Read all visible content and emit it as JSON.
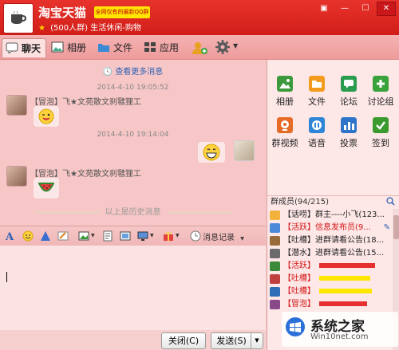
{
  "window": {
    "title": "淘宝天猫",
    "badge": "全网仅有的最新QQ群",
    "member_count": "(500人群)",
    "category": "生活休闲-购物",
    "controls": [
      "▣",
      "—",
      "☐",
      "✕"
    ]
  },
  "tabs": [
    {
      "label": "聊天",
      "icon": "chat-icon",
      "active": true
    },
    {
      "label": "相册",
      "icon": "album-icon"
    },
    {
      "label": "文件",
      "icon": "file-icon"
    },
    {
      "label": "应用",
      "icon": "apps-icon"
    }
  ],
  "chat": {
    "more_messages": "查看更多消息",
    "history_divider": "以上是历史消息",
    "messages": [
      {
        "time": "2014-4-10 19:05:52",
        "sender_tag": "【冒泡】",
        "sender": "飞★文苑散文刹毽狸工",
        "content": "wink-emoji"
      },
      {
        "time": "2014-4-10 19:14:04",
        "sender_tag": "",
        "sender": "",
        "content": "grin-emoji",
        "self": true
      },
      {
        "time": "",
        "sender_tag": "【冒泡】",
        "sender": "飞★文苑散文刹毽狸工",
        "content": "watermelon-emoji"
      }
    ]
  },
  "input_toolbar": {
    "message_record": "消息记录"
  },
  "buttons": {
    "close": "关闭(C)",
    "send": "发送(S)"
  },
  "apps": [
    {
      "label": "相册",
      "color": "#3c9a3c"
    },
    {
      "label": "文件",
      "color": "#f29c1f"
    },
    {
      "label": "论坛",
      "color": "#2a9c4f"
    },
    {
      "label": "讨论组",
      "color": "#3aa23a"
    },
    {
      "label": "群视频",
      "color": "#e56b26"
    },
    {
      "label": "语音",
      "color": "#2f86d6"
    },
    {
      "label": "投票",
      "color": "#2e74c9"
    },
    {
      "label": "签到",
      "color": "#3a9a2e"
    }
  ],
  "members": {
    "header": "群成员(94/215)",
    "list": [
      {
        "tag": "【话唠】",
        "name": "群主----小飞(123..."
      },
      {
        "tag": "【活跃】",
        "name": "信息发布员(9...",
        "red": true
      },
      {
        "tag": "【吐槽】",
        "name": "进群请看公告(18..."
      },
      {
        "tag": "【潜水】",
        "name": "进群请看公告(15..."
      },
      {
        "tag": "【活跃】",
        "name": "",
        "red": true
      },
      {
        "tag": "【吐槽】",
        "name": "",
        "red": true
      },
      {
        "tag": "【吐槽】",
        "name": "",
        "red": true
      },
      {
        "tag": "【冒泡】",
        "name": "",
        "red": true
      }
    ]
  },
  "watermark": {
    "brand": "系统之家",
    "site": "Win10net.com"
  }
}
